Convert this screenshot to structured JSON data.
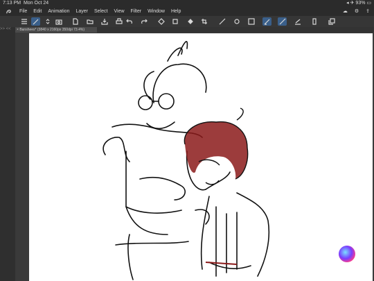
{
  "status": {
    "time": "7:13 PM",
    "date": "Mon Oct 24",
    "battery": "93%"
  },
  "menu": [
    "File",
    "Edit",
    "Animation",
    "Layer",
    "Select",
    "View",
    "Filter",
    "Window",
    "Help"
  ],
  "document_tab": {
    "label": "Banshees* (3840 x 2160px 350dpi 73.4%)"
  },
  "toolbar_icons": [
    "menu-icon",
    "brush-tool-icon",
    "stepper-icon",
    "camera-icon",
    "new-page-icon",
    "open-folder-icon",
    "save-icon",
    "print-icon",
    "undo-icon",
    "redo-icon",
    "layer-icon",
    "transform-icon",
    "fill-icon",
    "crop-icon",
    "ruler-icon",
    "snap-icon",
    "layer-select-icon",
    "pen-icon",
    "pencil-icon",
    "stroke-icon",
    "device-icon",
    "copy-icon"
  ],
  "left_strip": {
    "label": ">> <<"
  }
}
